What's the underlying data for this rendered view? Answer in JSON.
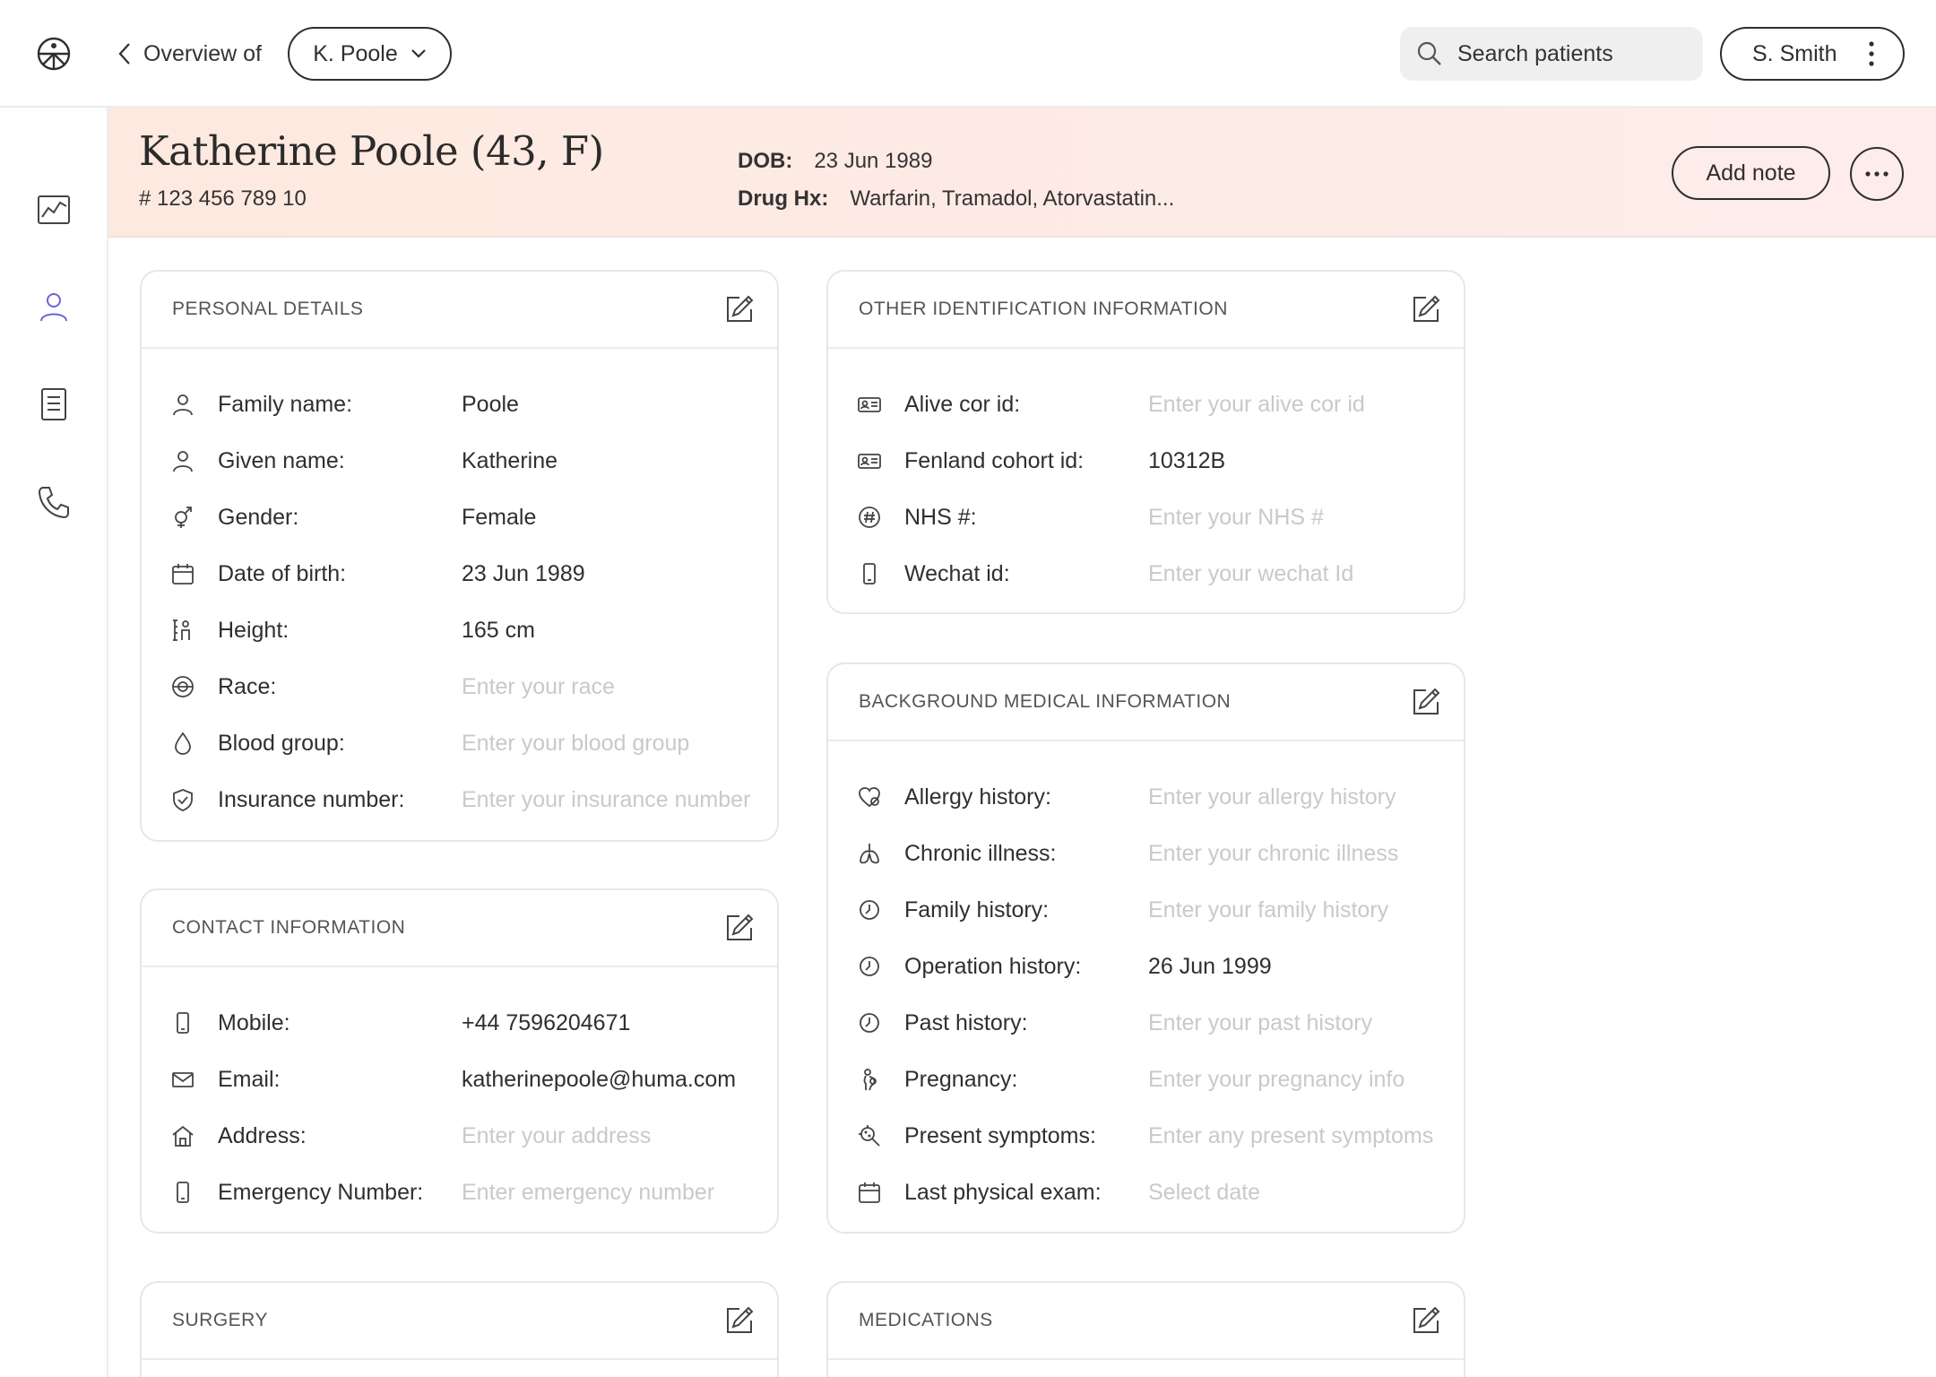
{
  "topbar": {
    "back_label": "Overview of",
    "patient_selector": "K. Poole",
    "search_placeholder": "Search patients",
    "user_name": "S. Smith"
  },
  "header": {
    "patient_name": "Katherine Poole (43, F)",
    "patient_id": "# 123 456 789 10",
    "dob_label": "DOB:",
    "dob_value": "23 Jun 1989",
    "drug_label": "Drug Hx:",
    "drug_value": "Warfarin, Tramadol, Atorvastatin...",
    "add_note_label": "Add note"
  },
  "sidenav": {
    "items": [
      {
        "icon": "chart-icon",
        "active": false
      },
      {
        "icon": "person-icon",
        "active": true
      },
      {
        "icon": "document-icon",
        "active": false
      },
      {
        "icon": "phone-icon",
        "active": false
      }
    ],
    "active_color": "#6c63d9"
  },
  "personal": {
    "title": "PERSONAL DETAILS",
    "rows": [
      {
        "icon": "person-icon",
        "label": "Family name:",
        "value": "Poole",
        "placeholder": ""
      },
      {
        "icon": "person-icon",
        "label": "Given name:",
        "value": "Katherine",
        "placeholder": ""
      },
      {
        "icon": "gender-icon",
        "label": "Gender:",
        "value": "Female",
        "placeholder": ""
      },
      {
        "icon": "calendar-icon",
        "label": "Date of birth:",
        "value": "23 Jun 1989",
        "placeholder": ""
      },
      {
        "icon": "height-icon",
        "label": "Height:",
        "value": "165 cm",
        "placeholder": ""
      },
      {
        "icon": "race-icon",
        "label": "Race:",
        "value": "",
        "placeholder": "Enter your race"
      },
      {
        "icon": "drop-icon",
        "label": "Blood group:",
        "value": "",
        "placeholder": "Enter your blood group"
      },
      {
        "icon": "shield-icon",
        "label": "Insurance number:",
        "value": "",
        "placeholder": "Enter your insurance number"
      }
    ]
  },
  "contact": {
    "title": "CONTACT INFORMATION",
    "rows": [
      {
        "icon": "phone-device-icon",
        "label": "Mobile:",
        "value": "+44 7596204671",
        "placeholder": ""
      },
      {
        "icon": "mail-icon",
        "label": "Email:",
        "value": "katherinepoole@huma.com",
        "placeholder": ""
      },
      {
        "icon": "home-icon",
        "label": "Address:",
        "value": "",
        "placeholder": "Enter your address"
      },
      {
        "icon": "phone-device-icon",
        "label": "Emergency Number:",
        "value": "",
        "placeholder": "Enter emergency number"
      }
    ]
  },
  "other_id": {
    "title": "OTHER IDENTIFICATION INFORMATION",
    "rows": [
      {
        "icon": "id-card-icon",
        "label": "Alive cor id:",
        "value": "",
        "placeholder": "Enter your alive cor id"
      },
      {
        "icon": "id-card-icon",
        "label": "Fenland cohort id:",
        "value": "10312B",
        "placeholder": ""
      },
      {
        "icon": "hash-icon",
        "label": "NHS #:",
        "value": "",
        "placeholder": "Enter your NHS #"
      },
      {
        "icon": "phone-device-icon",
        "label": "Wechat id:",
        "value": "",
        "placeholder": "Enter your wechat Id"
      }
    ]
  },
  "background": {
    "title": "BACKGROUND MEDICAL INFORMATION",
    "rows": [
      {
        "icon": "allergy-icon",
        "label": "Allergy history:",
        "value": "",
        "placeholder": "Enter your allergy history"
      },
      {
        "icon": "lungs-icon",
        "label": "Chronic illness:",
        "value": "",
        "placeholder": "Enter your chronic illness"
      },
      {
        "icon": "history-icon",
        "label": "Family history:",
        "value": "",
        "placeholder": "Enter your family history"
      },
      {
        "icon": "history-icon",
        "label": "Operation history:",
        "value": "26 Jun 1999",
        "placeholder": ""
      },
      {
        "icon": "history-icon",
        "label": "Past history:",
        "value": "",
        "placeholder": "Enter your past history"
      },
      {
        "icon": "pregnancy-icon",
        "label": "Pregnancy:",
        "value": "",
        "placeholder": "Enter your pregnancy info"
      },
      {
        "icon": "virus-icon",
        "label": "Present symptoms:",
        "value": "",
        "placeholder": "Enter any present symptoms"
      },
      {
        "icon": "calendar-icon",
        "label": "Last physical exam:",
        "value": "",
        "placeholder": "Select date"
      }
    ]
  },
  "surgery": {
    "title": "SURGERY"
  },
  "medications": {
    "title": "MEDICATIONS"
  }
}
